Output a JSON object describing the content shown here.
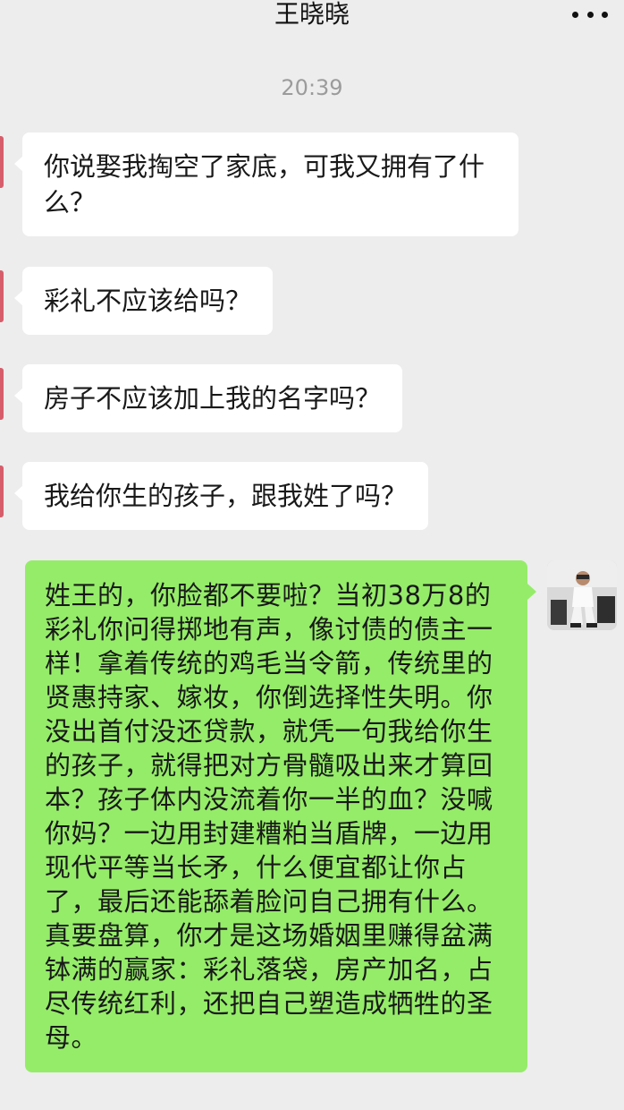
{
  "header": {
    "title": "王晓晓",
    "more_icon": "more-dots-icon"
  },
  "timestamp": "20:39",
  "messages": [
    {
      "side": "left",
      "text": "你说娶我掏空了家底，可我又拥有了什么？"
    },
    {
      "side": "left",
      "text": "彩礼不应该给吗？"
    },
    {
      "side": "left",
      "text": "房子不应该加上我的名字吗？"
    },
    {
      "side": "left",
      "text": "我给你生的孩子，跟我姓了吗？"
    },
    {
      "side": "right",
      "text": "姓王的，你脸都不要啦？当初38万8的彩礼你问得掷地有声，像讨债的债主一样！拿着传统的鸡毛当令箭，传统里的贤惠持家、嫁妆，你倒选择性失明。你没出首付没还贷款，就凭一句我给你生的孩子，就得把对方骨髓吸出来才算回本？孩子体内没流着你一半的血？没喊你妈？一边用封建糟粕当盾牌，一边用现代平等当长矛，什么便宜都让你占了，最后还能舔着脸问自己拥有什么。真要盘算，你才是这场婚姻里赚得盆满钵满的赢家：彩礼落袋，房产加名，占尽传统红利，还把自己塑造成牺牲的圣母。"
    }
  ],
  "colors": {
    "background": "#ededed",
    "bubble_left": "#ffffff",
    "bubble_right": "#95ec69",
    "timestamp": "#9b9b9b",
    "avatar_edge": "#d65e6b"
  }
}
